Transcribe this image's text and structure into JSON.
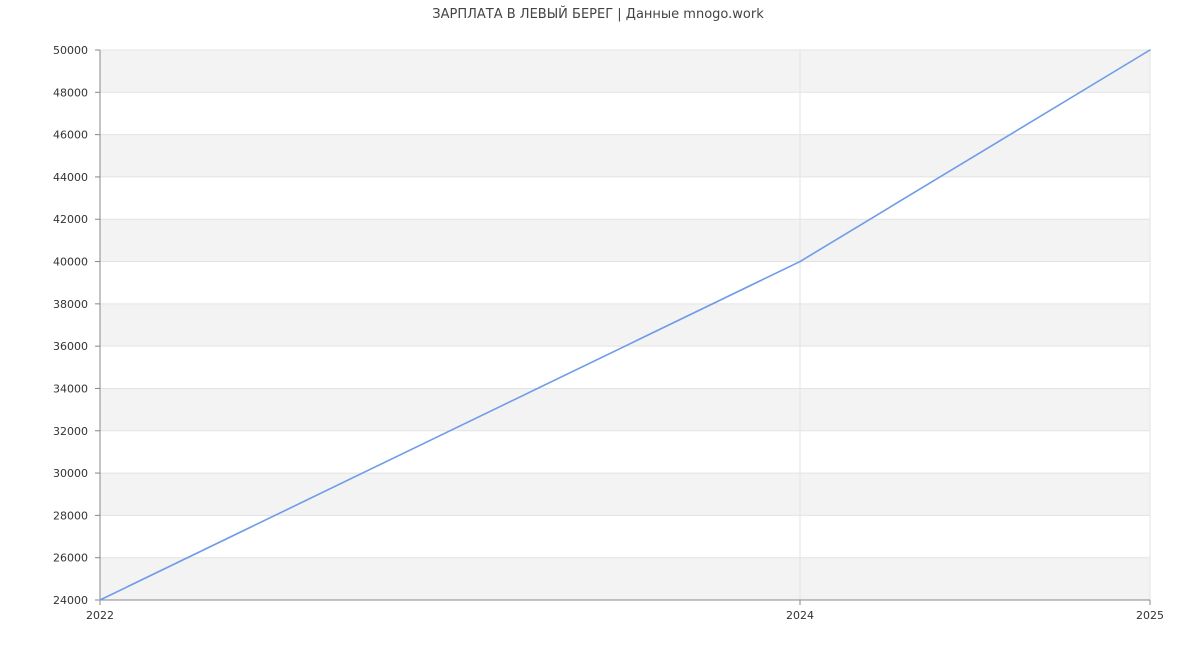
{
  "chart_data": {
    "type": "line",
    "title": "ЗАРПЛАТА В  ЛЕВЫЙ БЕРЕГ | Данные mnogo.work",
    "xlabel": "",
    "ylabel": "",
    "x": [
      2022,
      2024,
      2025
    ],
    "series": [
      {
        "values": [
          24000,
          40000,
          50000
        ]
      }
    ],
    "x_ticks": [
      "2022",
      "2024",
      "2025"
    ],
    "y_ticks": [
      24000,
      26000,
      28000,
      30000,
      32000,
      34000,
      36000,
      38000,
      40000,
      42000,
      44000,
      46000,
      48000,
      50000
    ],
    "xlim": [
      2022,
      2025
    ],
    "ylim": [
      24000,
      50000
    ],
    "grid": true,
    "legend": "none",
    "colors": {
      "line": "#6f9be8",
      "band": "#f3f3f3",
      "grid": "#e3e3e3",
      "axis": "#888888"
    }
  }
}
